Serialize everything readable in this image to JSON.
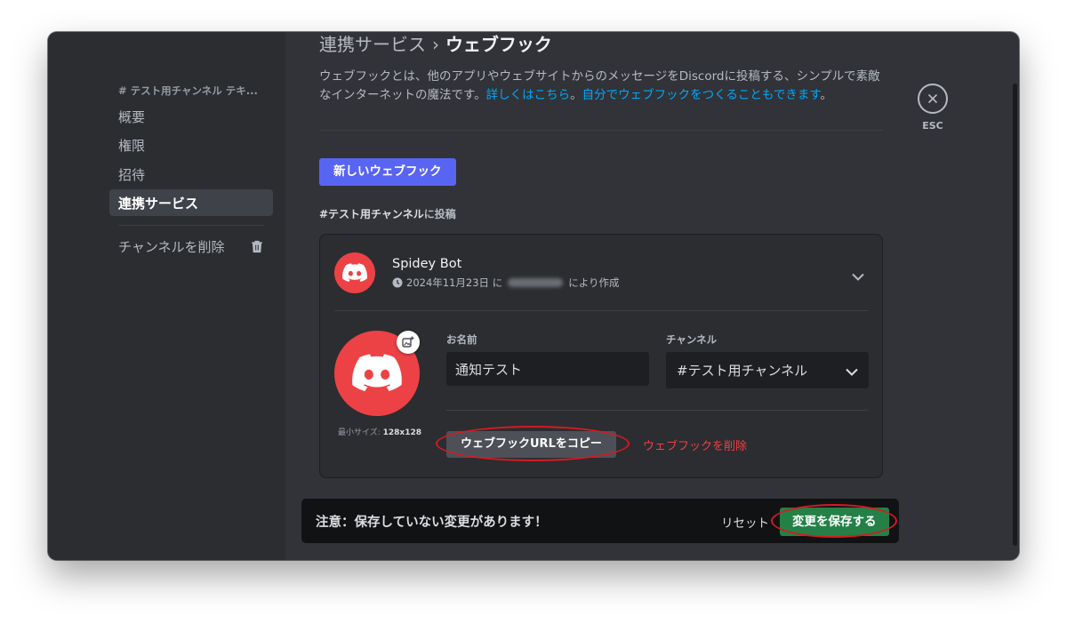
{
  "sidebar": {
    "header": "# テスト用チャンネル テキ...",
    "items": [
      {
        "label": "概要"
      },
      {
        "label": "権限"
      },
      {
        "label": "招待"
      },
      {
        "label": "連携サービス"
      }
    ],
    "delete_channel": "チャンネルを削除"
  },
  "page": {
    "breadcrumb": "連携サービス",
    "separator": "›",
    "title": "ウェブフック",
    "description": "ウェブフックとは、他のアプリやウェブサイトからのメッセージをDiscordに投稿する、シンプルで素敵なインターネットの魔法です。",
    "link_learn_more": "詳しくはこちら",
    "link_period": "。",
    "link_make_own": "自分でウェブフックをつくることもできます",
    "link_end": "。"
  },
  "new_webhook_label": "新しいウェブフック",
  "section": {
    "channel": "#テスト用チャンネル",
    "suffix": "に投稿"
  },
  "webhook": {
    "name": "Spidey Bot",
    "created_date": "2024年11月23日 に",
    "created_suffix": "により作成",
    "name_label": "お名前",
    "name_value": "通知テスト",
    "channel_label": "チャンネル",
    "channel_value": "#テスト用チャンネル",
    "min_size_label": "最小サイズ: ",
    "min_size_value": "128x128",
    "copy_url_label": "ウェブフックURLをコピー",
    "delete_label": "ウェブフックを削除"
  },
  "notice": {
    "text": "注意：保存していない変更があります！",
    "reset_label": "リセット",
    "save_label": "変更を保存する"
  },
  "esc_label": "ESC",
  "colors": {
    "blurple": "#5865f2",
    "red": "#ed4245",
    "green": "#248046",
    "link": "#00a8fc",
    "highlight_ring": "#d51a22"
  }
}
